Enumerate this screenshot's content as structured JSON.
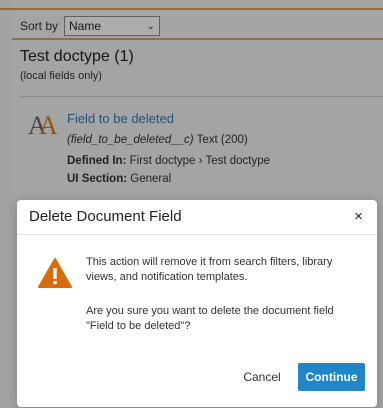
{
  "sort": {
    "label": "Sort by",
    "value": "Name"
  },
  "section": {
    "title": "Test doctype (1)",
    "subtitle": "(local fields only)"
  },
  "field": {
    "name": "Field to be deleted",
    "api_name": "(field_to_be_deleted__c)",
    "type": "Text (200)",
    "defined_in_label": "Defined In:",
    "defined_in_value": "First doctype › Test doctype",
    "ui_section_label": "UI Section:",
    "ui_section_value": "General",
    "icon": "text-field-icon"
  },
  "dialog": {
    "title": "Delete Document Field",
    "close": "×",
    "message1": "This action will remove it from search filters, library views, and notification templates.",
    "message2": "Are you sure you want to delete the document field \"Field to be deleted\"?",
    "cancel_label": "Cancel",
    "continue_label": "Continue",
    "icon": "warning-icon"
  },
  "colors": {
    "accent": "#d8a35a",
    "link": "#2c7cb5",
    "primary_button": "#1f87c7",
    "warning": "#d96b0a"
  }
}
